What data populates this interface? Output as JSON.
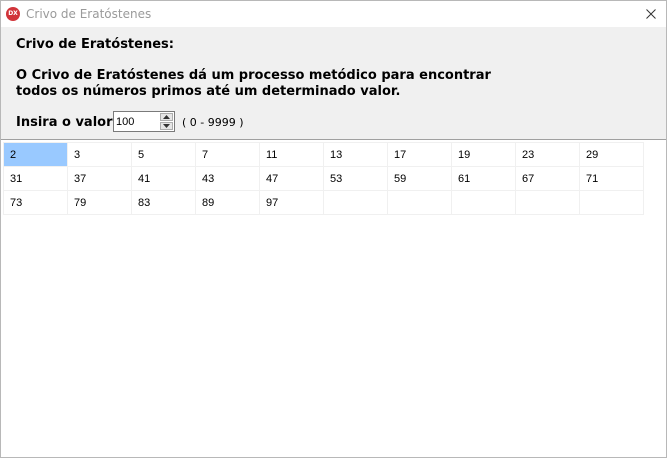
{
  "window": {
    "title": "Crivo de Eratóstenes",
    "icon_text": "DX",
    "icon": "app-logo-icon"
  },
  "header": {
    "heading": "Crivo de Eratóstenes:",
    "description": "O Crivo de Eratóstenes dá um processo metódico para encontrar todos os números primos até um determinado valor.",
    "input_label": "Insira o valor:",
    "input_value": "100",
    "range_hint": "( 0 - 9999 )"
  },
  "primes_grid": {
    "columns": 10,
    "selected": "2",
    "rows": [
      [
        "2",
        "3",
        "5",
        "7",
        "11",
        "13",
        "17",
        "19",
        "23",
        "29"
      ],
      [
        "31",
        "37",
        "41",
        "43",
        "47",
        "53",
        "59",
        "61",
        "67",
        "71"
      ],
      [
        "73",
        "79",
        "83",
        "89",
        "97",
        "",
        "",
        "",
        "",
        ""
      ]
    ]
  },
  "colors": {
    "selection": "#99c9ff",
    "panel": "#f0f0f0",
    "icon_red": "#d1343a"
  }
}
